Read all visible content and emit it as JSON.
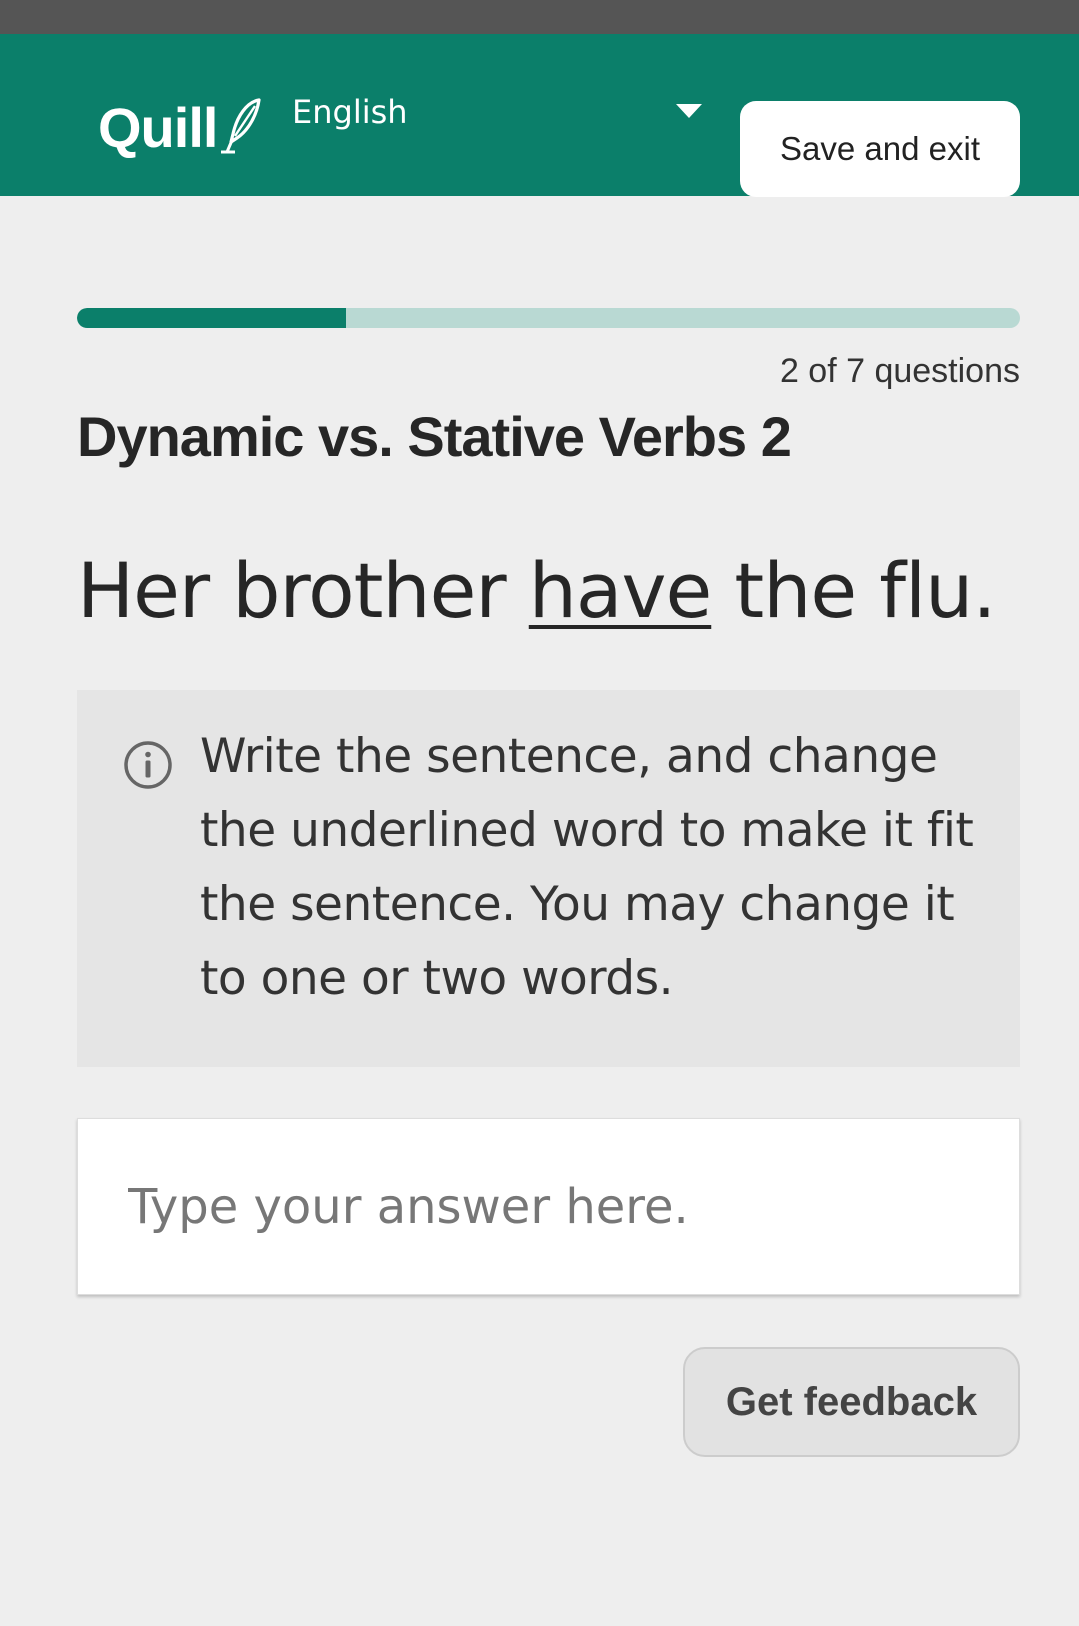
{
  "header": {
    "logo_text": "Quill",
    "language_label": "English",
    "save_label": "Save and exit",
    "brand_color": "#0b7f6a"
  },
  "progress": {
    "current": 2,
    "total": 7,
    "fraction": 0.2857,
    "label": "2 of 7 questions"
  },
  "activity": {
    "title": "Dynamic vs. Stative Verbs 2"
  },
  "prompt": {
    "before": "Her brother ",
    "underlined": "have",
    "after": " the flu."
  },
  "instructions": {
    "icon": "info-icon",
    "text": "Write the sentence, and change the underlined word to make it fit the sentence. You may change it to one or two words."
  },
  "answer": {
    "value": "",
    "placeholder": "Type your answer here."
  },
  "actions": {
    "feedback_label": "Get feedback"
  }
}
